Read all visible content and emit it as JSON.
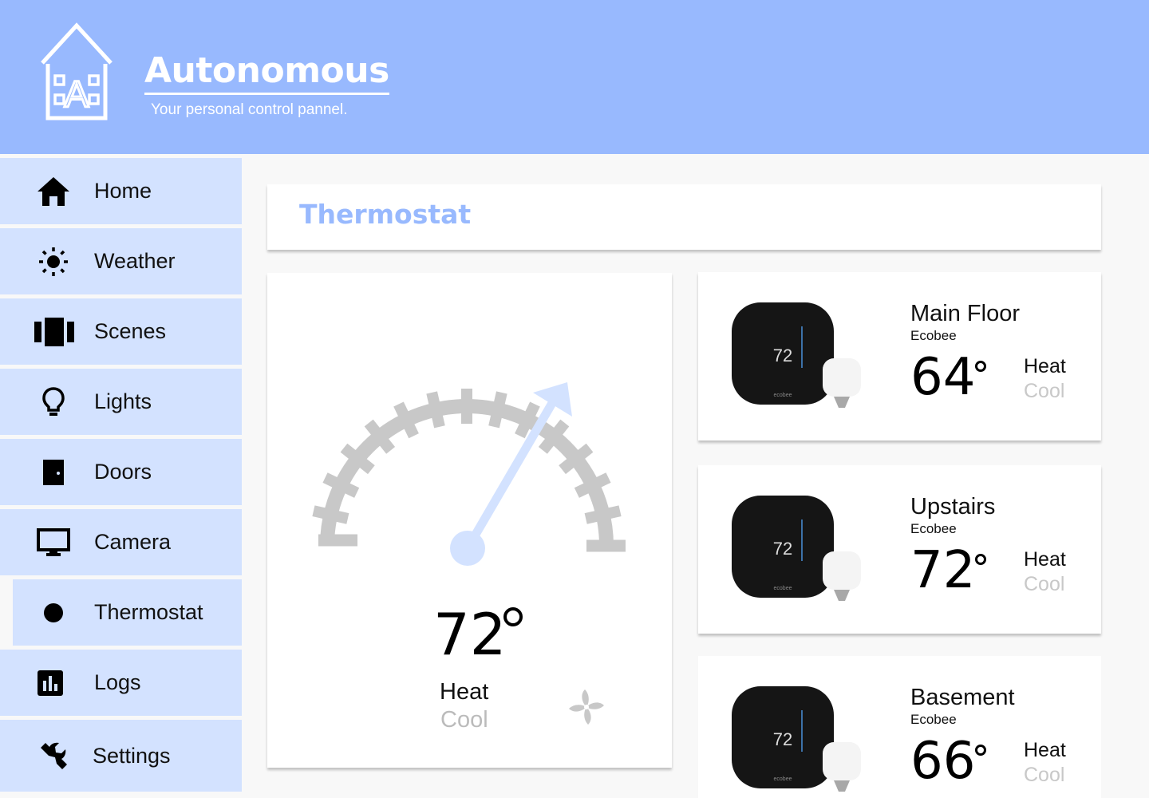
{
  "header": {
    "title": "Autonomous",
    "subtitle": "Your personal control pannel.",
    "logo_letter": "A"
  },
  "nav": [
    {
      "label": "Home",
      "icon": "home-icon"
    },
    {
      "label": "Weather",
      "icon": "sun-icon"
    },
    {
      "label": "Scenes",
      "icon": "scenes-icon"
    },
    {
      "label": "Lights",
      "icon": "lightbulb-icon"
    },
    {
      "label": "Doors",
      "icon": "door-icon"
    },
    {
      "label": "Camera",
      "icon": "monitor-icon"
    },
    {
      "label": "Thermostat",
      "icon": "circle-icon",
      "active": true
    },
    {
      "label": "Logs",
      "icon": "chart-icon"
    },
    {
      "label": "Settings",
      "icon": "wrench-icon"
    }
  ],
  "page": {
    "title": "Thermostat"
  },
  "main": {
    "temperature": "72",
    "modes": {
      "heat": "Heat",
      "cool": "Cool"
    },
    "active_mode": "Heat"
  },
  "zones": [
    {
      "name": "Main Floor",
      "brand": "Ecobee",
      "temperature": "64",
      "heat": "Heat",
      "cool": "Cool",
      "display": "72"
    },
    {
      "name": "Upstairs",
      "brand": "Ecobee",
      "temperature": "72",
      "heat": "Heat",
      "cool": "Cool",
      "display": "72"
    },
    {
      "name": "Basement",
      "brand": "Ecobee",
      "temperature": "66",
      "heat": "Heat",
      "cool": "Cool",
      "display": "72"
    }
  ],
  "device_label": "ecobee",
  "colors": {
    "header": "#98b9fe",
    "nav_bg": "#d3e2ff",
    "accent": "#98b9fe",
    "needle": "#d3e2ff",
    "gauge": "#c8c8c8",
    "inactive_text": "#bbbbbb"
  }
}
